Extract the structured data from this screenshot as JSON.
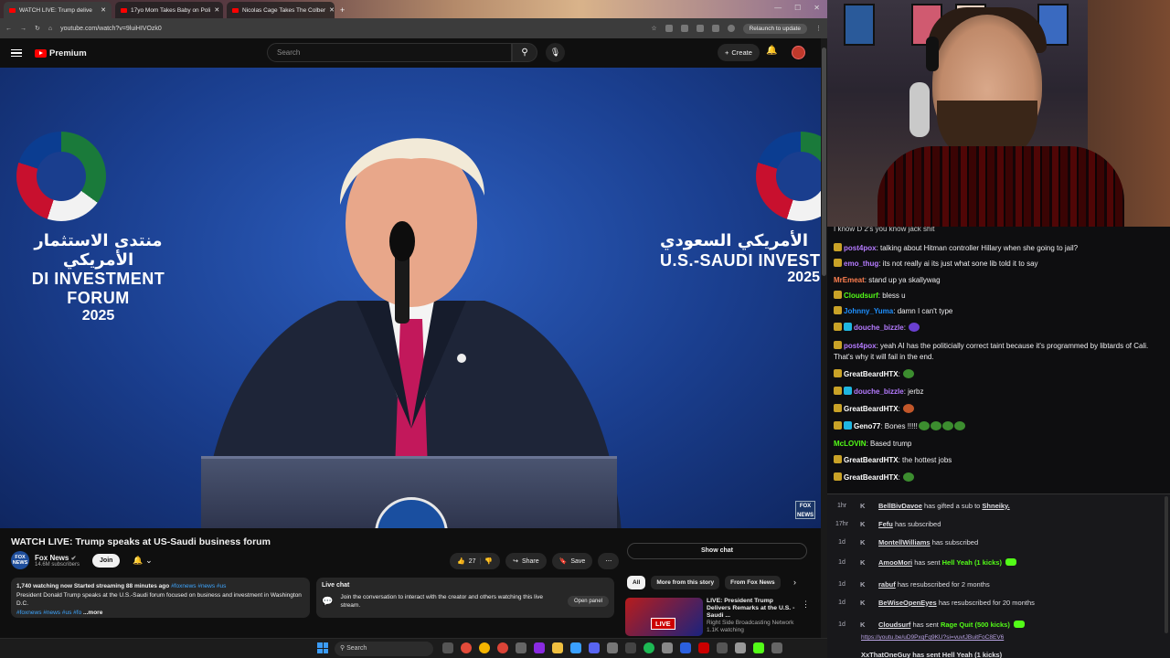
{
  "browser": {
    "tabs": [
      {
        "label": "WATCH LIVE: Trump delive",
        "active": true
      },
      {
        "label": "17yo Mom Takes Baby on Poli",
        "active": false
      },
      {
        "label": "Nicolas Cage Takes The Colber",
        "active": false
      }
    ],
    "url": "youtube.com/watch?v=9luiHIVOzk0",
    "relaunch_label": "Relaunch to update"
  },
  "youtube": {
    "logo_label": "Premium",
    "search_placeholder": "Search",
    "create_label": "Create",
    "video": {
      "forum_ar_left": "منتدى الاستثمار الأمريكي",
      "forum_en_left": "DI INVESTMENT FORUM",
      "forum_year_left": "2025",
      "forum_ar_right": "الأمريكي السعودي",
      "forum_en_right": "U.S.-SAUDI INVEST",
      "forum_year_right": "2025",
      "bug_label": "FOX NEWS"
    },
    "title": "WATCH LIVE: Trump speaks at US-Saudi business forum",
    "channel": {
      "name": "Fox News",
      "subscribers": "14.6M subscribers",
      "avatar_text": "FOX NEWS",
      "join_label": "Join"
    },
    "actions": {
      "likes": "27",
      "share_label": "Share",
      "save_label": "Save"
    },
    "description": {
      "meta": "1,740 watching now  Started streaming 88 minutes ago",
      "meta_tags": "#foxnews #news #us",
      "text": "President Donald Trump speaks at the U.S.-Saudi forum focused on business and investment in Washington D.C.",
      "tags": "#foxnews #news #us #fo",
      "more_label": "...more"
    },
    "live_chat": {
      "heading": "Live chat",
      "message": "Join the conversation to interact with the creator and others watching this live stream.",
      "open_label": "Open panel"
    },
    "show_chat_label": "Show chat",
    "chips": [
      "All",
      "More from this story",
      "From Fox News"
    ],
    "recommended": {
      "title": "LIVE: President Trump Delivers Remarks at the U.S. - Saudi ...",
      "channel": "Right Side Broadcasting Network",
      "watching": "1.1K watching",
      "badge": "LIVE"
    }
  },
  "taskbar": {
    "search_label": "Search"
  },
  "chat": {
    "top_partial": "I know D 2's you know jack shit",
    "messages": [
      {
        "user": "post4pox",
        "color": "#b57bff",
        "text": "talking about Hitman controller Hillary when she going to jail?",
        "badges": [
          "gold"
        ]
      },
      {
        "user": "emo_thug",
        "color": "#b57bff",
        "text": "its not really ai its just what sone lib told it to say",
        "badges": [
          "gold"
        ]
      },
      {
        "user": "MrEmeat",
        "color": "#ff7f50",
        "text": "stand up ya skallywag",
        "badges": []
      },
      {
        "user": "Cloudsurf",
        "color": "#53fc18",
        "text": "bless u",
        "badges": [
          "gold"
        ]
      },
      {
        "user": "Johnny_Yuma",
        "color": "#1e90ff",
        "text": "damn I can't type",
        "badges": [
          "gold"
        ]
      },
      {
        "user": "douche_bizzle",
        "color": "#b57bff",
        "text": "",
        "badges": [
          "gold",
          "cyan"
        ],
        "emotes": [
          "purple"
        ]
      },
      {
        "user": "post4pox",
        "color": "#b57bff",
        "text": "yeah AI has the politicially correct taint because it's programmed by libtards of Cali. That's why it will fail in the end.",
        "badges": [
          "gold"
        ]
      },
      {
        "user": "GreatBeardHTX",
        "color": "#ffffff",
        "text": "",
        "badges": [
          "gold"
        ],
        "emotes": [
          "green"
        ]
      },
      {
        "user": "douche_bizzle",
        "color": "#b57bff",
        "text": "jerbz",
        "badges": [
          "gold",
          "cyan"
        ]
      },
      {
        "user": "GreatBeardHTX",
        "color": "#ffffff",
        "text": "",
        "badges": [
          "gold"
        ],
        "emotes": [
          "red"
        ]
      },
      {
        "user": "Geno77",
        "color": "#ffffff",
        "text": "Bones !!!!!",
        "badges": [
          "gold",
          "cyan"
        ],
        "emotes": [
          "green",
          "green",
          "green",
          "green"
        ]
      },
      {
        "user": "McLOVIN",
        "color": "#53fc18",
        "text": "Based trump",
        "badges": []
      },
      {
        "user": "GreatBeardHTX",
        "color": "#ffffff",
        "text": "the hottest jobs",
        "badges": [
          "gold"
        ]
      },
      {
        "user": "GreatBeardHTX",
        "color": "#ffffff",
        "text": "",
        "badges": [
          "gold"
        ],
        "emotes": [
          "green"
        ]
      }
    ]
  },
  "feed": [
    {
      "time": "1hr",
      "user": "BellBivDavoe",
      "text": "has gifted a sub to",
      "extra": "Shneiky."
    },
    {
      "time": "17hr",
      "user": "Fefu",
      "text": "has subscribed",
      "extra": ""
    },
    {
      "time": "1d",
      "user": "MontellWilliams",
      "text": "has subscribed",
      "extra": ""
    },
    {
      "time": "1d",
      "user": "AmooMori",
      "text": "has sent",
      "extra": "Hell Yeah (1 kicks)"
    },
    {
      "time": "1d",
      "user": "rabuf",
      "text": "has resubscribed for 2 months",
      "extra": ""
    },
    {
      "time": "1d",
      "user": "BeWiseOpenEyes",
      "text": "has resubscribed for 20 months",
      "extra": ""
    },
    {
      "time": "1d",
      "user": "Cloudsurf",
      "text": "has sent",
      "extra": "Rage Quit (500 kicks)"
    }
  ],
  "feed_link": "https://youtu.be/uD9PxqFq9KU?si=vuvtJBuitFoC8EV6",
  "feed_last_partial": "XxThatOneGuy has sent Hell Yeah (1 kicks)"
}
